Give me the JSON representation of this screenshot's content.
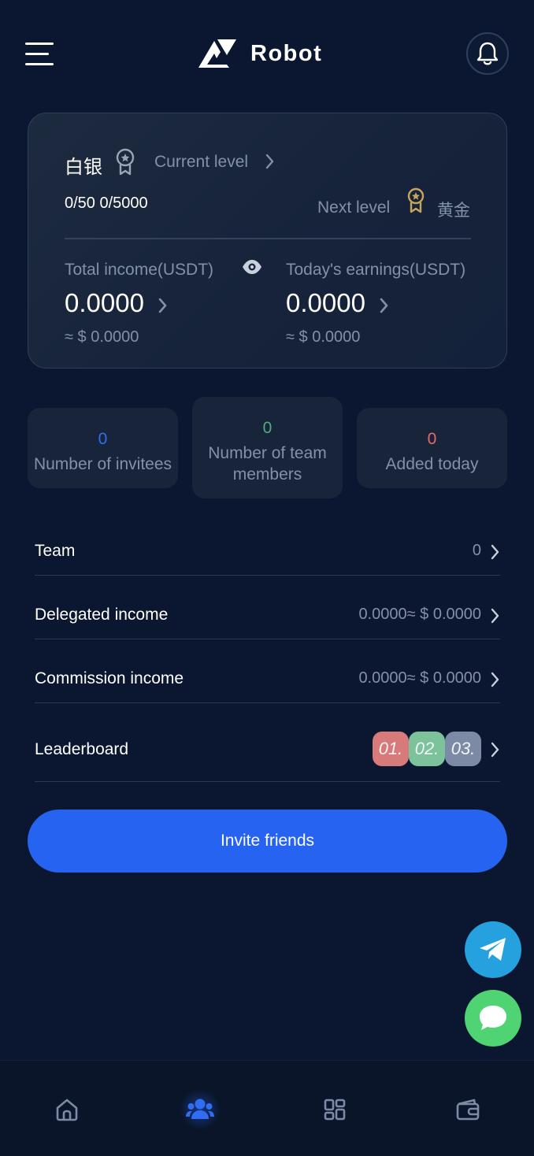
{
  "header": {
    "brand_name": "Robot",
    "menu_icon": "hamburger-menu-icon",
    "notification_icon": "bell-icon"
  },
  "level_card": {
    "current_level_name": "白银",
    "current_level_label": "Current level",
    "progress_text": "0/50  0/5000",
    "next_level_label": "Next level",
    "next_level_name": "黄金",
    "total_income_label": "Total income(USDT)",
    "total_income_value": "0.0000",
    "total_income_approx": "≈ $ 0.0000",
    "today_earnings_label": "Today's earnings(USDT)",
    "today_earnings_value": "0.0000",
    "today_earnings_approx": "≈ $ 0.0000"
  },
  "tiles": [
    {
      "count": "0",
      "label": "Number of invitees"
    },
    {
      "count": "0",
      "label": "Number of team members"
    },
    {
      "count": "0",
      "label": "Added today"
    }
  ],
  "rows": {
    "team": {
      "label": "Team",
      "value": "0"
    },
    "delegated": {
      "label": "Delegated income",
      "value": "0.0000≈ $ 0.0000"
    },
    "commission": {
      "label": "Commission income",
      "value": "0.0000≈ $ 0.0000"
    },
    "leaderboard": {
      "label": "Leaderboard",
      "ranks": [
        {
          "text": "01.",
          "color": "#d97a7a"
        },
        {
          "text": "02.",
          "color": "#7cc39b"
        },
        {
          "text": "03.",
          "color": "#7d8aa6"
        }
      ]
    }
  },
  "invite_button": "Invite friends",
  "fabs": {
    "telegram": "telegram-icon",
    "chat": "chat-bubble-icon"
  },
  "bottom_nav": {
    "items": [
      "home-icon",
      "team-icon",
      "apps-icon",
      "wallet-icon"
    ],
    "active": "team-icon"
  },
  "colors": {
    "background": "#0b1730",
    "accent": "#2563f0",
    "muted_text": "#8391a8"
  }
}
